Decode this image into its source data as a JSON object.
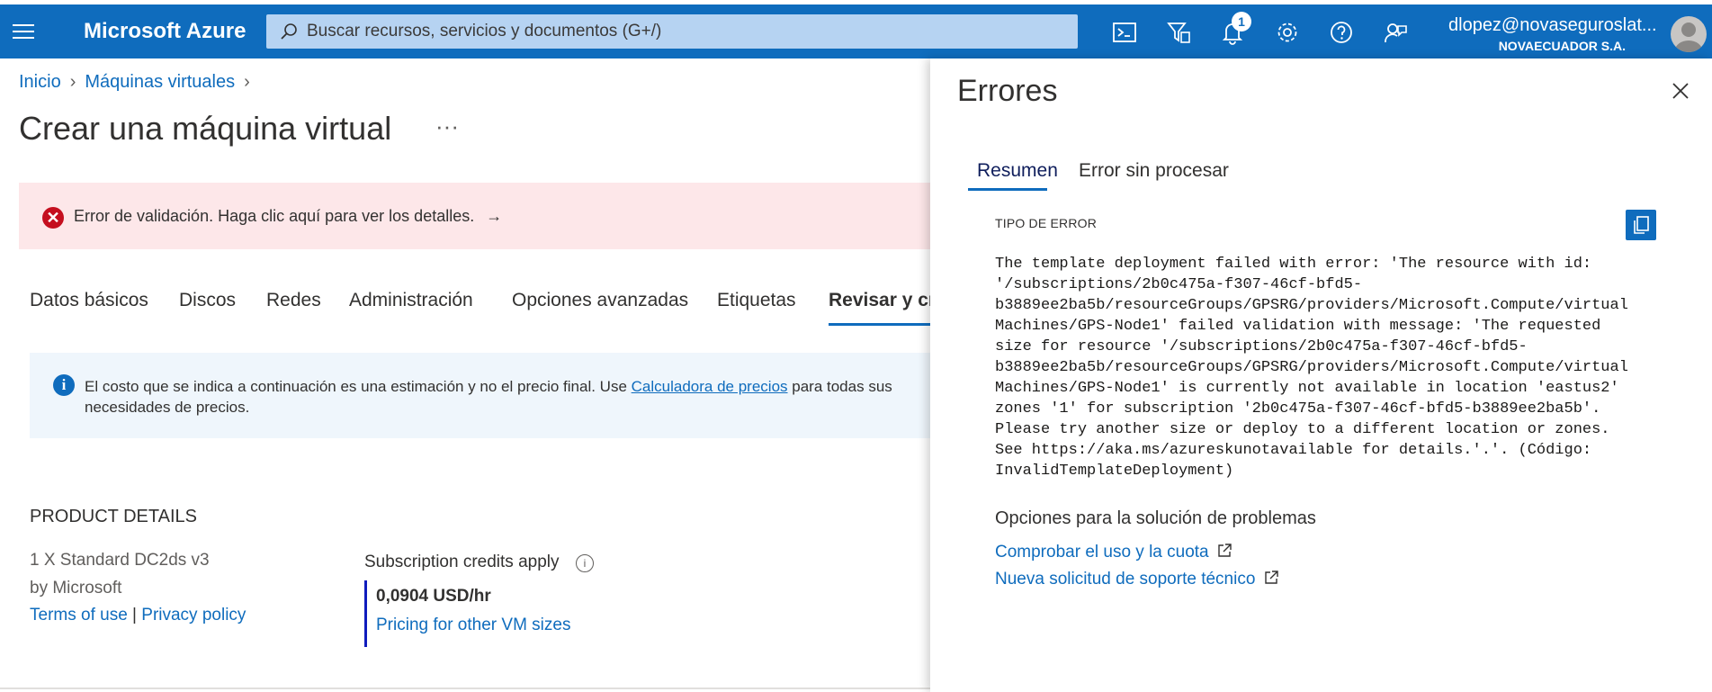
{
  "topbar": {
    "brand": "Microsoft Azure",
    "search_placeholder": "Buscar recursos, servicios y documentos (G+/)",
    "notification_count": "1",
    "account_name": "dlopez@novaseguroslat...",
    "account_org": "NOVAECUADOR S.A."
  },
  "breadcrumb": {
    "items": [
      "Inicio",
      "Máquinas virtuales"
    ]
  },
  "page": {
    "title": "Crear una máquina virtual",
    "more": "···"
  },
  "alert": {
    "message": "Error de validación. Haga clic aquí para ver los detalles.",
    "arrow": "→"
  },
  "tabs": [
    {
      "label": "Datos básicos"
    },
    {
      "label": "Discos"
    },
    {
      "label": "Redes"
    },
    {
      "label": "Administración"
    },
    {
      "label": "Opciones avanzadas"
    },
    {
      "label": "Etiquetas"
    },
    {
      "label": "Revisar y cre"
    }
  ],
  "info": {
    "text_before": "El costo que se indica a continuación es una estimación y no el precio final. Use ",
    "link": "Calculadora de precios",
    "text_after": " para todas sus",
    "line2": "necesidades de precios."
  },
  "product": {
    "heading": "PRODUCT DETAILS",
    "name": "1 X Standard DC2ds v3",
    "by": "by Microsoft",
    "terms": "Terms of use",
    "pipe": "|",
    "privacy": "Privacy policy",
    "credits": "Subscription credits apply",
    "price": "0,0904 USD/hr",
    "price_link": "Pricing for other VM sizes"
  },
  "panel": {
    "title": "Errores",
    "tabs": [
      "Resumen",
      "Error sin procesar"
    ],
    "type_label": "TIPO DE ERROR",
    "error_text": "The template deployment failed with error: 'The resource with id:\n'/subscriptions/2b0c475a-f307-46cf-bfd5-\nb3889ee2ba5b/resourceGroups/GPSRG/providers/Microsoft.Compute/virtual\nMachines/GPS-Node1' failed validation with message: 'The requested\nsize for resource '/subscriptions/2b0c475a-f307-46cf-bfd5-\nb3889ee2ba5b/resourceGroups/GPSRG/providers/Microsoft.Compute/virtual\nMachines/GPS-Node1' is currently not available in location 'eastus2'\nzones '1' for subscription '2b0c475a-f307-46cf-bfd5-b3889ee2ba5b'.\nPlease try another size or deploy to a different location or zones.\nSee https://aka.ms/azureskunotavailable for details.'.'. (Código:\nInvalidTemplateDeployment)",
    "troubleshoot_heading": "Opciones para la solución de problemas",
    "links": [
      "Comprobar el uso y la cuota",
      "Nueva solicitud de soporte técnico"
    ]
  },
  "colors": {
    "accent": "#0f6cbd",
    "error": "#c50f1f",
    "error_bg": "#fde7e9",
    "info_bg": "#eff6fc"
  }
}
